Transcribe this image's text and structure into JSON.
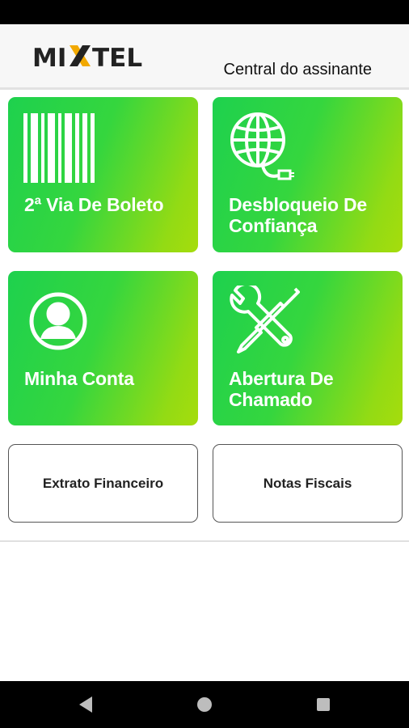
{
  "header": {
    "logo_text": "MIXTEL",
    "title": "Central do assinante"
  },
  "tiles": [
    {
      "label": "2ª Via De Boleto",
      "icon": "barcode-icon"
    },
    {
      "label": "Desbloqueio De\nConfiança",
      "icon": "globe-network-icon"
    },
    {
      "label": "Minha Conta",
      "icon": "user-icon"
    },
    {
      "label": "Abertura De\nChamado",
      "icon": "tools-icon"
    }
  ],
  "buttons": [
    {
      "label": "Extrato Financeiro"
    },
    {
      "label": "Notas Fiscais"
    }
  ],
  "nav": {
    "back": "back-icon",
    "home": "home-icon",
    "recents": "recents-icon"
  },
  "colors": {
    "tile_gradient_start": "#1ed14e",
    "tile_gradient_end": "#a6dc0c",
    "brand_accent": "#f2a900"
  }
}
